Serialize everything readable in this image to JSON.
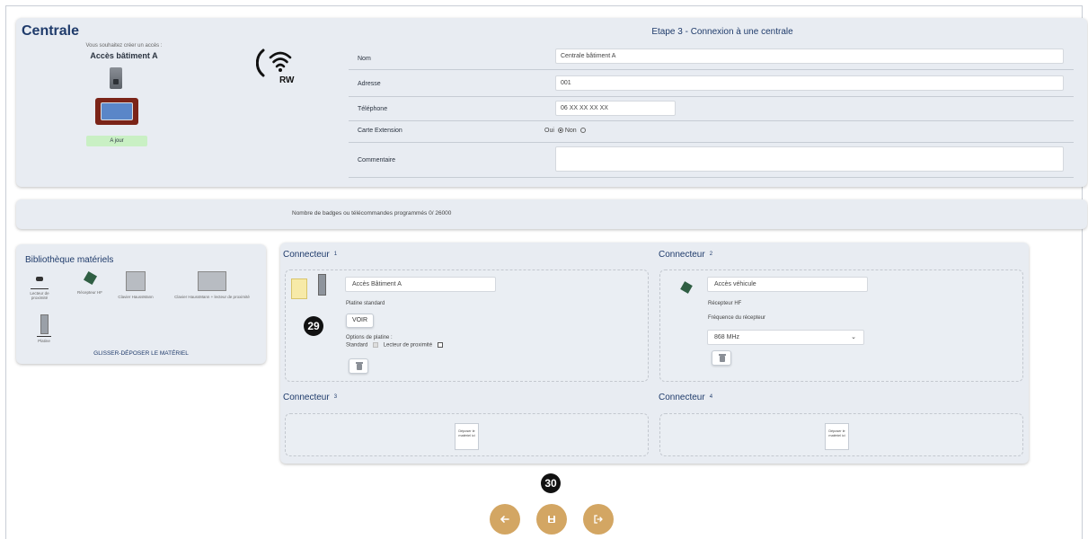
{
  "centrale": {
    "title": "Centrale",
    "subtitle": "Vous souhaitez créer un accès :",
    "access_name": "Accès bâtiment A",
    "status": "A jour",
    "wifi_badge": "RW"
  },
  "form": {
    "step_title": "Etape 3 - Connexion à une centrale",
    "nom_label": "Nom",
    "nom_value": "Centrale bâtiment A",
    "adresse_label": "Adresse",
    "adresse_value": "001",
    "telephone_label": "Téléphone",
    "telephone_value": "06 XX XX XX XX",
    "carte_label": "Carte Extension",
    "carte_oui": "Oui",
    "carte_non": "Non",
    "carte_selected": "Non",
    "commentaire_label": "Commentaire",
    "commentaire_value": ""
  },
  "badges": {
    "text": "Nombre de badges ou télécommandes programmés 0/ 26000"
  },
  "library": {
    "title": "Bibliothèque matériels",
    "items": [
      "Lecteur de proximité",
      "Récepteur HF",
      "Clavier HaussMann",
      "Clavier HaussMann + lecteur de proximité",
      "Platine"
    ],
    "footer": "GLISSER-DÉPOSER LE MATÉRIEL"
  },
  "connectors": {
    "title": "Connecteur",
    "c1": {
      "number": "1",
      "name": "Accès Bâtiment A",
      "type": "Platine standard",
      "voir": "VOIR",
      "options_label": "Options de platine :",
      "standard": "Standard",
      "proximite": "Lecteur de proximité"
    },
    "c2": {
      "number": "2",
      "name": "Accès véhicule",
      "type": "Récepteur HF",
      "freq_label": "Fréquence du récepteur",
      "freq_value": "868 MHz"
    },
    "c3": {
      "number": "3",
      "drop": "Déposer le matériel ici"
    },
    "c4": {
      "number": "4",
      "drop": "Déposer le matériel ici"
    }
  },
  "markers": {
    "m1": "29",
    "m2": "30"
  },
  "colors": {
    "accent": "#d3a663",
    "panel": "#e8ecf2",
    "title": "#1f3b6b"
  }
}
